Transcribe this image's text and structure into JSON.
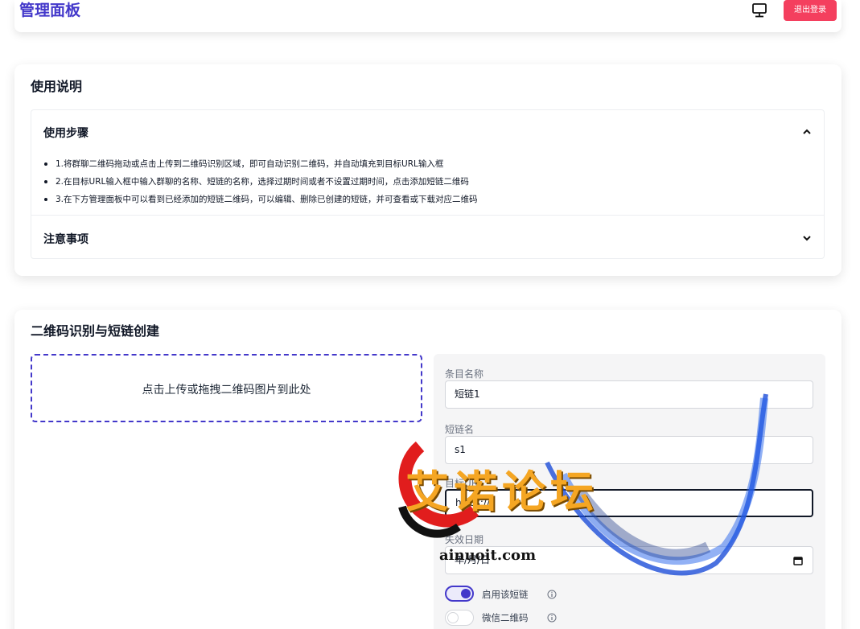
{
  "header": {
    "title": "管理面板",
    "monitor_icon": "monitor-icon",
    "logout_label": "退出登录",
    "accent": "#4338ca",
    "logout_color": "#f43f5e"
  },
  "usage": {
    "title": "使用说明",
    "steps_title": "使用步骤",
    "steps": [
      "1.将群聊二维码拖动或点击上传到二维码识别区域，即可自动识别二维码，并自动填充到目标URL输入框",
      "2.在目标URL输入框中输入群聊的名称、短链的名称，选择过期时间或者不设置过期时间，点击添加短链二维码",
      "3.在下方管理面板中可以看到已经添加的短链二维码，可以编辑、删除已创建的短链，并可查看或下载对应二维码"
    ],
    "notes_title": "注意事项"
  },
  "qr": {
    "title": "二维码识别与短链创建",
    "dropzone_text": "点击上传或拖拽二维码图片到此处",
    "form": {
      "name_label": "条目名称",
      "name_value": "短链1",
      "slug_label": "短链名",
      "slug_value": "s1",
      "url_label": "目标URL",
      "url_value": "https://",
      "expire_label": "失效日期",
      "expire_value": "年/月/日",
      "enable_label": "启用该短链",
      "enable_on": true,
      "wechat_label": "微信二维码",
      "wechat_on": false
    }
  },
  "watermark": {
    "text": "艾诺论坛",
    "url": "ainuoit.com"
  }
}
